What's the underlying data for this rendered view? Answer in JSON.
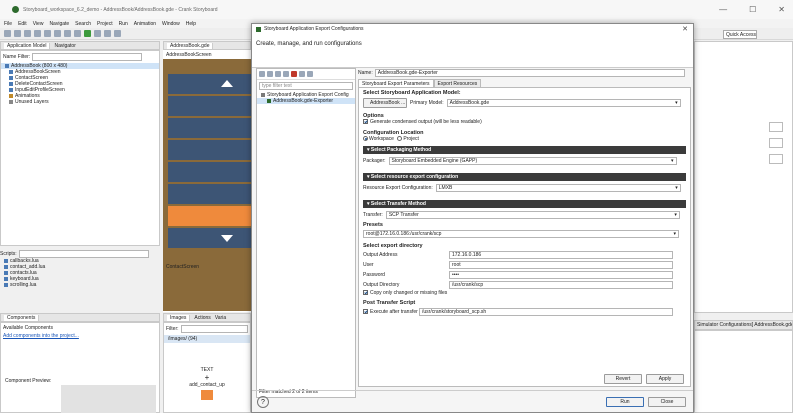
{
  "window": {
    "title": "Storyboard_workspace_6.2_demo - AddressBook/AddressBook.gde - Crank Storyboard",
    "min": "—",
    "max": "☐",
    "close": "✕"
  },
  "menu": [
    "File",
    "Edit",
    "View",
    "Navigate",
    "Search",
    "Project",
    "Run",
    "Animation",
    "Window",
    "Help"
  ],
  "quick_access": "Quick Access",
  "app_model": {
    "tab1": "Application Model",
    "tab2": "Navigator",
    "filter_label": "Name Filter:",
    "items": [
      "AddressBook (800 x 480)",
      "AddressBookScreen",
      "ContactScreen",
      "DeleteContactScreen",
      "InputEditProfileScreen",
      "Animations",
      "Unused Layers"
    ]
  },
  "scripts": {
    "label": "Scripts:",
    "items": [
      "callbacks.lua",
      "contact_add.lua",
      "contacts.lua",
      "keyboard.lua",
      "scrolling.lua"
    ]
  },
  "components": {
    "tab": "Components",
    "available": "Available Components",
    "link": "Add components into the project...",
    "preview": "Component Preview:"
  },
  "editor": {
    "tab": "AddressBook.gde",
    "screen1": "AddressBookScreen",
    "screen2": "ContactScreen"
  },
  "images": {
    "tab1": "Images",
    "tab2": "Actions",
    "tab3": "Varia",
    "filter_label": "Filter:",
    "folder": "/images/ (94)",
    "text_label": "TEXT",
    "item": "add_contact_up"
  },
  "dialog": {
    "title": "Storyboard Application Export Configurations",
    "close": "✕",
    "banner": "Create, manage, and run configurations",
    "filter_placeholder": "type filter text",
    "tree": [
      "Storyboard Application Export Config",
      "AddressBook.gde-Exporter"
    ],
    "filter_status": "Filter matched 2 of 2 items",
    "name_label": "Name:",
    "name_value": "AddressBook.gde-Exporter",
    "tabs": [
      "Storyboard Export Parameters",
      "Export Resources"
    ],
    "model_heading": "Select Storyboard Application Model:",
    "model_btn": "AddressBook ...",
    "primary_model_label": "Primary Model:",
    "primary_model_value": "AddressBook.gde",
    "options_heading": "Options",
    "condensed_label": "Generate condensed output (will be less readable)",
    "config_loc_heading": "Configuration Location",
    "loc_workspace": "Workspace",
    "loc_project": "Project",
    "pack_section": "Select Packaging Method",
    "packager_label": "Packager:",
    "packager_value": "Storyboard Embedded Engine (GAPP)",
    "res_section": "Select resource export configuration",
    "res_label": "Resource Export Configuration:",
    "res_value": "LMXB",
    "transfer_section": "Select Transfer Method",
    "transfer_label": "Transfer:",
    "transfer_value": "SCP Transfer",
    "presets_heading": "Presets",
    "presets_value": "root@172.16.0.186:/usr/crank/scp",
    "export_dir_heading": "Select export directory",
    "output_address_label": "Output Address",
    "output_address_value": "172.16.0.186",
    "user_label": "User",
    "user_value": "root",
    "password_label": "Password",
    "password_value": "••••",
    "output_dir_label": "Output Directory",
    "output_dir_value": "/usr/crank/scp",
    "copy_changed_label": "Copy only changed or missing files",
    "post_heading": "Post Transfer Script",
    "execute_label": "Execute after transfer",
    "execute_value": "/usr/crank/storyboard_scp.sh",
    "revert": "Revert",
    "apply": "Apply",
    "run": "Run",
    "close_btn": "Close",
    "help": "?"
  },
  "right_side": {
    "tab_label": "Simulator Configurations] AddressBook.gde"
  },
  "colors": {
    "nav_blue": "#3d5575",
    "accent_orange": "#ef8a3c",
    "section_dark": "#3b3b3b"
  }
}
